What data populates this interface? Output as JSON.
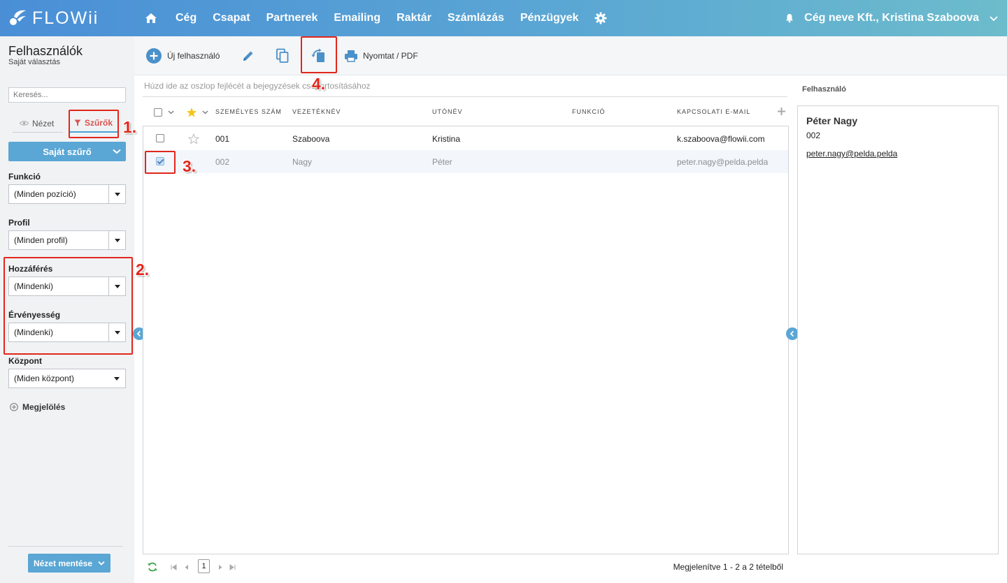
{
  "app": {
    "logo_text": "FLOWii"
  },
  "nav": {
    "items": [
      "Cég",
      "Csapat",
      "Partnerek",
      "Emailing",
      "Raktár",
      "Számlázás",
      "Pénzügyek"
    ],
    "user": "Cég neve Kft., Kristina Szaboova"
  },
  "sidebar": {
    "title": "Felhasználók",
    "subtitle": "Saját választás",
    "search_placeholder": "Keresés...",
    "tab_view": "Nézet",
    "tab_filters": "Szűrők",
    "own_filter": "Saját szűrő",
    "filters": [
      {
        "label": "Funkció",
        "value": "(Minden pozíció)"
      },
      {
        "label": "Profil",
        "value": "(Minden profil)"
      },
      {
        "label": "Hozzáférés",
        "value": "(Mindenki)"
      },
      {
        "label": "Érvényesség",
        "value": "(Mindenki)"
      },
      {
        "label": "Központ",
        "value": "(Miden központ)"
      }
    ],
    "mark_label": "Megjelölés",
    "save_view": "Nézet mentése"
  },
  "toolbar": {
    "new_user": "Új felhasználó",
    "print": "Nyomtat / PDF"
  },
  "grid": {
    "group_hint": "Húzd ide az oszlop fejlécét a bejegyzések csoportosításához",
    "columns": [
      "Személyes szám",
      "Vezetéknév",
      "Utónév",
      "Funkció",
      "Kapcsolati e-mail"
    ],
    "rows": [
      {
        "number": "001",
        "last": "Szaboova",
        "first": "Kristina",
        "function": "",
        "email": "k.szaboova@flowii.com",
        "checked": false
      },
      {
        "number": "002",
        "last": "Nagy",
        "first": "Péter",
        "function": "",
        "email": "peter.nagy@pelda.pelda",
        "checked": true
      }
    ],
    "pager_page": "1",
    "pager_info": "Megjelenítve 1 - 2 a 2 tételből"
  },
  "detail": {
    "tab": "Felhasználó",
    "name": "Péter Nagy",
    "number": "002",
    "email": "peter.nagy@pelda.pelda"
  },
  "annotations": [
    "1.",
    "2.",
    "3.",
    "4."
  ],
  "colors": {
    "accent": "#5aa6d4",
    "annotation": "#e2261b",
    "filter_tab": "#d9534f"
  }
}
